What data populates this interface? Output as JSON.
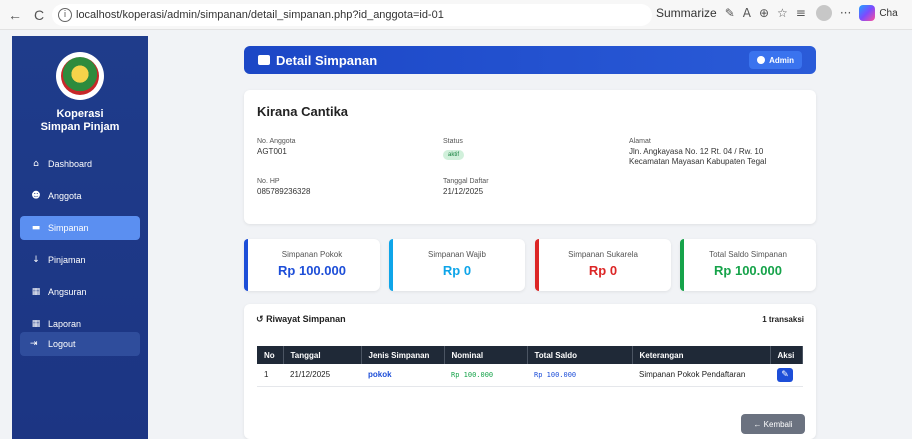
{
  "browser": {
    "url": "localhost/koperasi/admin/simpanan/detail_simpanan.php?id_anggota=id-01",
    "summarize_label": "Summarize",
    "profile_label": "Cha"
  },
  "sidebar": {
    "brand_line1": "Koperasi",
    "brand_line2": "Simpan Pinjam",
    "items": [
      {
        "label": "Dashboard",
        "icon": "home-icon"
      },
      {
        "label": "Anggota",
        "icon": "users-icon"
      },
      {
        "label": "Simpanan",
        "icon": "wallet-icon"
      },
      {
        "label": "Pinjaman",
        "icon": "hand-coin-icon"
      },
      {
        "label": "Angsuran",
        "icon": "calendar-icon"
      },
      {
        "label": "Laporan",
        "icon": "calendar-icon"
      }
    ],
    "logout_label": "Logout",
    "active_color": "#5b8ff1"
  },
  "header": {
    "title": "Detail Simpanan",
    "admin_label": "Admin"
  },
  "profile": {
    "name": "Kirana Cantika",
    "no_anggota_label": "No. Anggota",
    "no_anggota": "AGT001",
    "status_label": "Status",
    "status": "aktif",
    "alamat_label": "Alamat",
    "alamat_line1": "Jln. Angkayasa No. 12 Rt. 04 / Rw. 10",
    "alamat_line2": "Kecamatan Mayasan Kabupaten Tegal",
    "no_hp_label": "No. HP",
    "no_hp": "085789236328",
    "tanggal_label": "Tanggal Daftar",
    "tanggal": "21/12/2025"
  },
  "stats": [
    {
      "label": "Simpanan Pokok",
      "value": "Rp 100.000",
      "color": "#1d4ed8"
    },
    {
      "label": "Simpanan Wajib",
      "value": "Rp 0",
      "color": "#0ea5e9"
    },
    {
      "label": "Simpanan Sukarela",
      "value": "Rp 0",
      "color": "#dc2626"
    },
    {
      "label": "Total Saldo Simpanan",
      "value": "Rp 100.000",
      "color": "#16a34a"
    }
  ],
  "history": {
    "title": "Riwayat Simpanan",
    "count": "1 transaksi",
    "columns": [
      "No",
      "Tanggal",
      "Jenis Simpanan",
      "Nominal",
      "Total Saldo",
      "Keterangan",
      "Aksi"
    ],
    "rows": [
      {
        "no": "1",
        "tanggal": "21/12/2025",
        "jenis": "pokok",
        "nominal": "Rp 100.000",
        "total": "Rp 100.000",
        "keterangan": "Simpanan Pokok Pendaftaran"
      }
    ],
    "back_label": "← Kembali"
  }
}
